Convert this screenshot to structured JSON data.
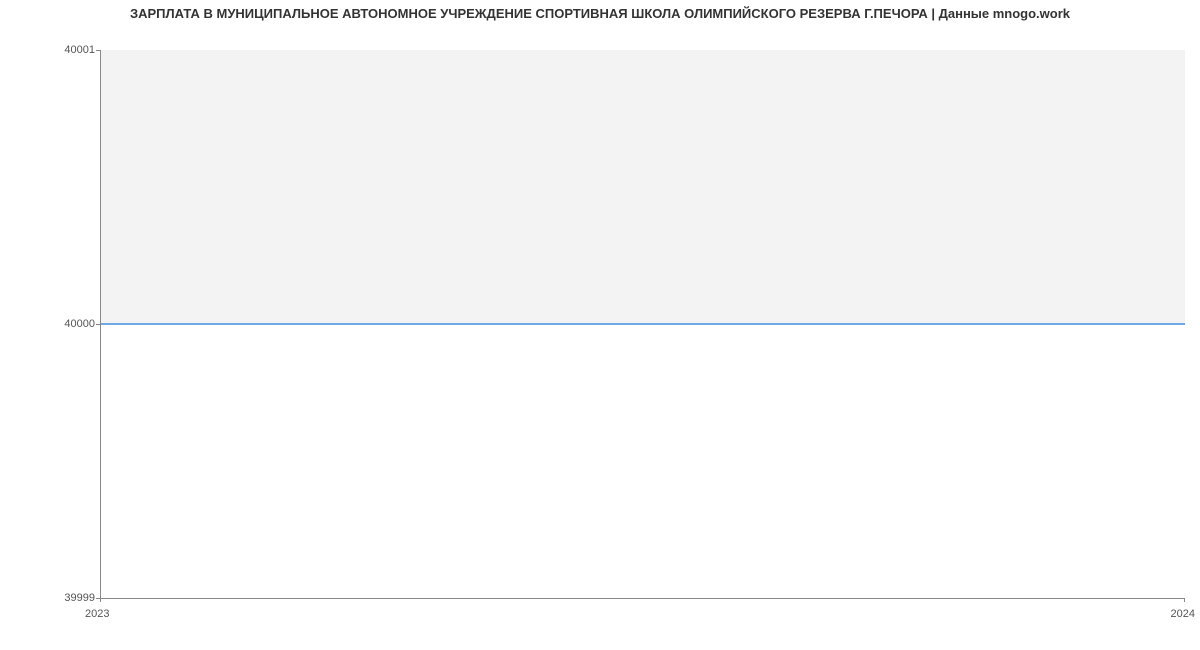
{
  "chart_data": {
    "type": "area",
    "title": "ЗАРПЛАТА В МУНИЦИПАЛЬНОЕ АВТОНОМНОЕ УЧРЕЖДЕНИЕ  СПОРТИВНАЯ ШКОЛА ОЛИМПИЙСКОГО РЕЗЕРВА Г.ПЕЧОРА | Данные mnogo.work",
    "x": [
      2023,
      2024
    ],
    "series": [
      {
        "name": "Зарплата",
        "values": [
          40000,
          40000
        ]
      }
    ],
    "xlabel": "",
    "ylabel": "",
    "ylim": [
      39999,
      40001
    ],
    "xlim": [
      2023,
      2024
    ],
    "y_ticks": [
      39999,
      40000,
      40001
    ],
    "x_ticks": [
      2023,
      2024
    ]
  },
  "labels": {
    "ytick_top": "40001",
    "ytick_mid": "40000",
    "ytick_bot": "39999",
    "xtick_left": "2023",
    "xtick_right": "2024"
  }
}
